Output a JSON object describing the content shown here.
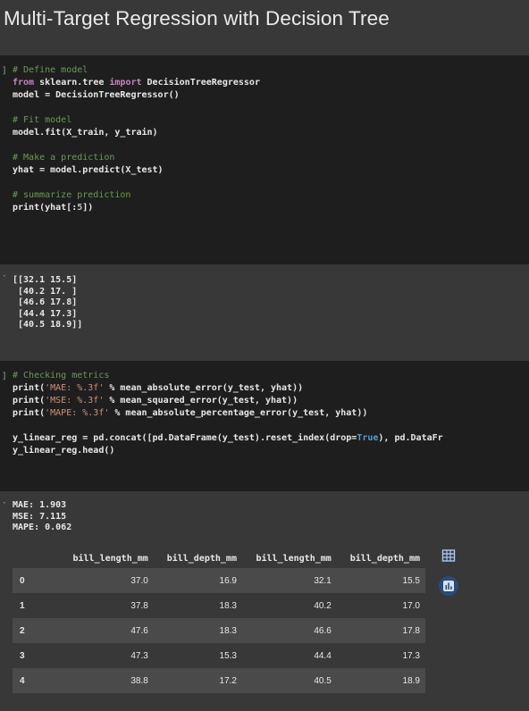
{
  "title": "Multi-Target Regression with Decision Tree",
  "cell1": {
    "gutter": "]",
    "lines": [
      "# Define model",
      "from sklearn.tree import DecisionTreeRegressor",
      "model = DecisionTreeRegressor()",
      "",
      "# Fit model",
      "model.fit(X_train, y_train)",
      "",
      "# Make a prediction",
      "yhat = model.predict(X_test)",
      "",
      "# summarize prediction",
      "print(yhat[:5])"
    ]
  },
  "output1": {
    "gutter": "·",
    "text": "[[32.1 15.5]\n [40.2 17. ]\n [46.6 17.8]\n [44.4 17.3]\n [40.5 18.9]]"
  },
  "cell2": {
    "gutter": "]",
    "lines": [
      "# Checking metrics",
      "print('MAE: %.3f' % mean_absolute_error(y_test, yhat))",
      "print('MSE: %.3f' % mean_squared_error(y_test, yhat))",
      "print('MAPE: %.3f' % mean_absolute_percentage_error(y_test, yhat))",
      "",
      "y_linear_reg = pd.concat([pd.DataFrame(y_test).reset_index(drop=True), pd.DataFr",
      "y_linear_reg.head()"
    ]
  },
  "output2": {
    "gutter": "·",
    "text": "MAE: 1.903\nMSE: 7.115\nMAPE: 0.062"
  },
  "dataframe": {
    "columns": [
      "",
      "bill_length_mm",
      "bill_depth_mm",
      "bill_length_mm",
      "bill_depth_mm"
    ],
    "rows": [
      [
        "0",
        "37.0",
        "16.9",
        "32.1",
        "15.5"
      ],
      [
        "1",
        "37.8",
        "18.3",
        "40.2",
        "17.0"
      ],
      [
        "2",
        "47.6",
        "18.3",
        "46.6",
        "17.8"
      ],
      [
        "3",
        "47.3",
        "15.3",
        "44.4",
        "17.3"
      ],
      [
        "4",
        "38.8",
        "17.2",
        "40.5",
        "18.9"
      ]
    ]
  },
  "buttons": {
    "table_icon": "table-view-icon",
    "chart_icon": "suggest-chart-icon",
    "accent": "#1e3a5f"
  }
}
